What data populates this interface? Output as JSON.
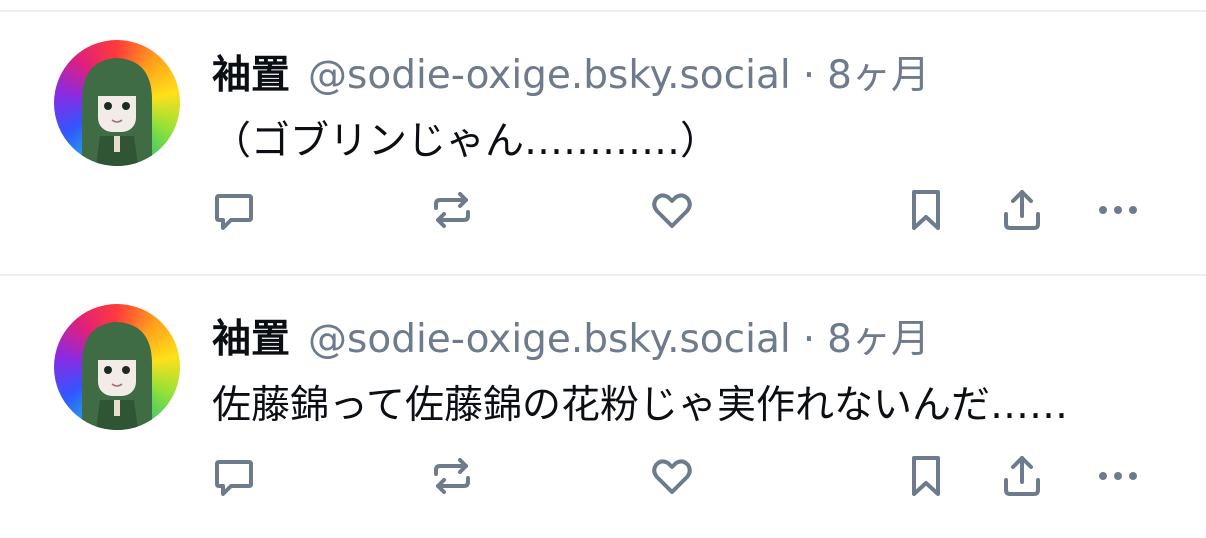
{
  "posts": [
    {
      "display_name": "袖置",
      "handle": "@sodie-oxige.bsky.social",
      "separator": "·",
      "time": "8ヶ月",
      "text": "（ゴブリンじゃん…………）",
      "avatar_icon": "avatar-girl-icon"
    },
    {
      "display_name": "袖置",
      "handle": "@sodie-oxige.bsky.social",
      "separator": "·",
      "time": "8ヶ月",
      "text": "佐藤錦って佐藤錦の花粉じゃ実作れないんだ……",
      "avatar_icon": "avatar-girl-icon"
    }
  ],
  "action_icons": [
    "reply-icon",
    "repost-icon",
    "like-icon",
    "bookmark-icon",
    "share-icon",
    "more-icon"
  ],
  "colors": {
    "text_primary": "#0b0f14",
    "text_secondary": "#6e7b8c",
    "icon": "#6e7b8c",
    "divider": "#eceef1"
  }
}
